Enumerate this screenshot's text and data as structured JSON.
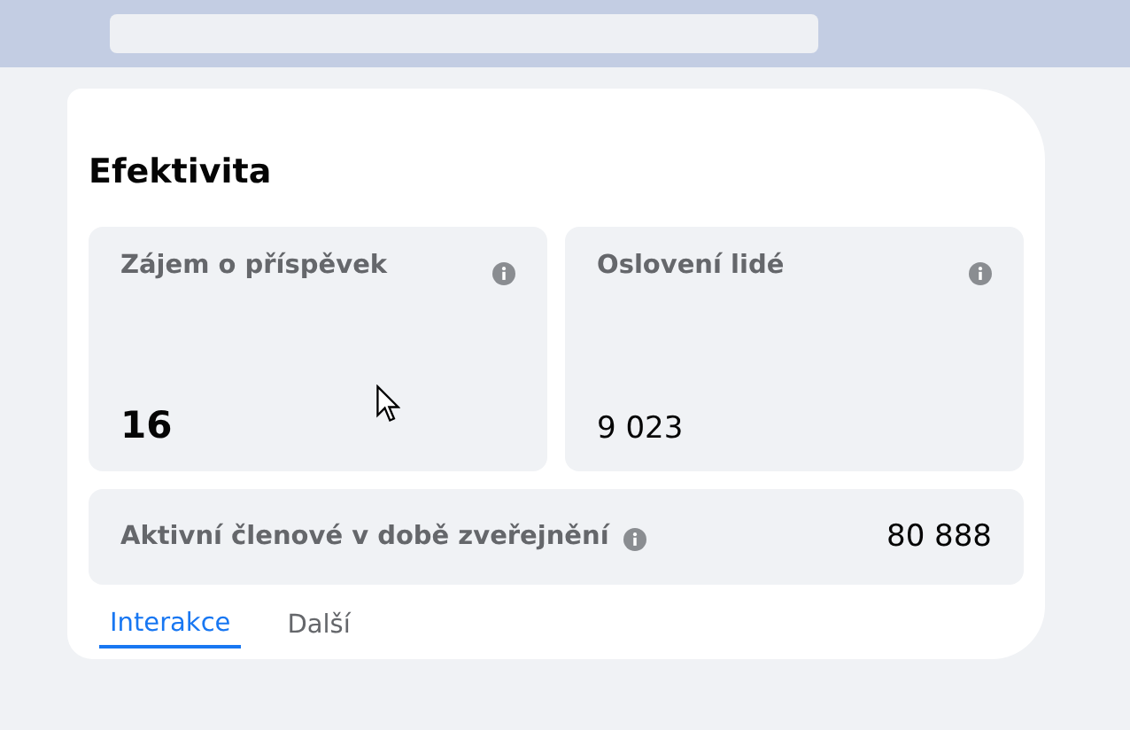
{
  "section": {
    "title": "Efektivita"
  },
  "metrics": [
    {
      "label": "Zájem o příspěvek",
      "value": "16",
      "emphasis": true
    },
    {
      "label": "Oslovení lidé",
      "value": "9 023",
      "emphasis": false
    }
  ],
  "summary": {
    "label": "Aktivní členové v době zveřejnění",
    "value": "80 888"
  },
  "tabs": [
    {
      "label": "Interakce",
      "selected": true
    },
    {
      "label": "Další",
      "selected": false
    }
  ]
}
